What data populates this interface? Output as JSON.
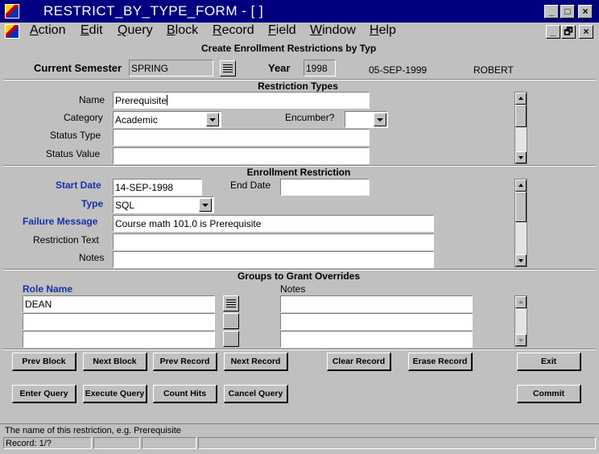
{
  "window": {
    "title": "RESTRICT_BY_TYPE_FORM - [ ]",
    "controls": [
      "_",
      "□",
      "×"
    ],
    "mdi_controls": [
      "_",
      "🗗",
      "×"
    ]
  },
  "menu": [
    "Action",
    "Edit",
    "Query",
    "Block",
    "Record",
    "Field",
    "Window",
    "Help"
  ],
  "form_title": "Create Enrollment Restrictions by Typ",
  "header": {
    "semester_label": "Current Semester",
    "semester_value": "SPRING",
    "year_label": "Year",
    "year_value": "1998",
    "date": "05-SEP-1999",
    "user": "ROBERT"
  },
  "restriction_types": {
    "title": "Restriction Types",
    "name_label": "Name",
    "name_value": "Prerequisite",
    "category_label": "Category",
    "category_value": "Academic",
    "encumber_label": "Encumber?",
    "encumber_value": "",
    "status_type_label": "Status Type",
    "status_type_value": "",
    "status_value_label": "Status Value",
    "status_value_value": ""
  },
  "enrollment_restriction": {
    "title": "Enrollment Restriction",
    "start_date_label": "Start Date",
    "start_date_value": "14-SEP-1998",
    "end_date_label": "End Date",
    "end_date_value": "",
    "type_label": "Type",
    "type_value": "SQL",
    "failure_label": "Failure Message",
    "failure_value": "Course math 101.0 is Prerequisite",
    "restriction_text_label": "Restriction Text",
    "restriction_text_value": "",
    "notes_label": "Notes",
    "notes_value": ""
  },
  "groups": {
    "title": "Groups to Grant Overrides",
    "role_label": "Role Name",
    "notes_label": "Notes",
    "rows": [
      {
        "role": "DEAN",
        "notes": ""
      },
      {
        "role": "",
        "notes": ""
      },
      {
        "role": "",
        "notes": ""
      }
    ]
  },
  "buttons": {
    "prev_block": "Prev Block",
    "next_block": "Next Block",
    "prev_record": "Prev Record",
    "next_record": "Next Record",
    "clear_record": "Clear Record",
    "erase_record": "Erase Record",
    "exit": "Exit",
    "enter_query": "Enter Query",
    "execute_query": "Execute Query",
    "count_hits": "Count Hits",
    "cancel_query": "Cancel Query",
    "commit": "Commit"
  },
  "status": {
    "hint": "The name of this restriction, e.g.  Prerequisite",
    "record": "Record: 1/?"
  }
}
